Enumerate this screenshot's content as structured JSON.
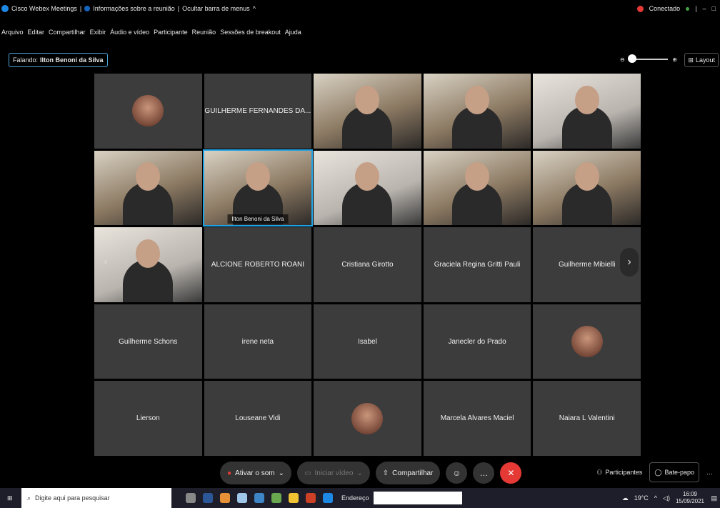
{
  "titlebar": {
    "app_name": "Cisco Webex Meetings",
    "meeting_info": "Informações sobre a reunião",
    "hide_menu": "Ocultar barra de menus",
    "status": "Conectado",
    "window_controls": [
      "–",
      "□"
    ]
  },
  "menu": [
    "Arquivo",
    "Editar",
    "Compartilhar",
    "Exibir",
    "Áudio e vídeo",
    "Participante",
    "Reunião",
    "Sessões de breakout",
    "Ajuda"
  ],
  "speaker": {
    "prefix": "Falando:",
    "name": "Ilton Benoni da Silva"
  },
  "layout_label": "Layout",
  "tiles": [
    {
      "type": "avatar",
      "name": ""
    },
    {
      "type": "name",
      "name": "GUILHERME FERNANDES DA..."
    },
    {
      "type": "video",
      "name": ""
    },
    {
      "type": "video",
      "name": ""
    },
    {
      "type": "video",
      "name": ""
    },
    {
      "type": "video",
      "name": ""
    },
    {
      "type": "video",
      "name": "Ilton Benoni da Silva",
      "active": true
    },
    {
      "type": "video",
      "name": ""
    },
    {
      "type": "video",
      "name": ""
    },
    {
      "type": "video",
      "name": ""
    },
    {
      "type": "video",
      "name": ""
    },
    {
      "type": "name",
      "name": "ALCIONE ROBERTO ROANI"
    },
    {
      "type": "name",
      "name": "Cristiana Girotto"
    },
    {
      "type": "name",
      "name": "Graciela Regina Gritti Pauli"
    },
    {
      "type": "name",
      "name": "Guilherme Mibielli"
    },
    {
      "type": "name",
      "name": "Guilherme Schons"
    },
    {
      "type": "name",
      "name": "irene neta"
    },
    {
      "type": "name",
      "name": "Isabel"
    },
    {
      "type": "name",
      "name": "Janecler do Prado"
    },
    {
      "type": "avatar",
      "name": ""
    },
    {
      "type": "name",
      "name": "Lierson"
    },
    {
      "type": "name",
      "name": "Louseane Vidi"
    },
    {
      "type": "avatar",
      "name": ""
    },
    {
      "type": "name",
      "name": "Marcela Alvares Maciel"
    },
    {
      "type": "name",
      "name": "Naiara L Valentini"
    }
  ],
  "controls": {
    "unmute": "Ativar o som",
    "start_video": "Iniciar vídeo",
    "share": "Compartilhar",
    "participants": "Participantes",
    "chat": "Bate-papo"
  },
  "taskbar": {
    "search_placeholder": "Digite aqui para pesquisar",
    "address_label": "Endereço",
    "temperature": "19°C",
    "time": "16:09",
    "date": "15/09/2021"
  }
}
